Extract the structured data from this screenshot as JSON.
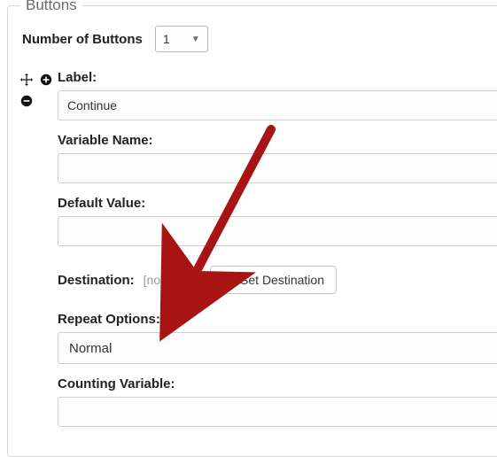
{
  "group": {
    "title": "Buttons",
    "number_label": "Number of Buttons",
    "number_value": "1"
  },
  "button": {
    "label_label": "Label:",
    "label_value": "Continue",
    "variable_label": "Variable Name:",
    "variable_value": "",
    "default_label": "Default Value:",
    "default_value": "",
    "destination_label": "Destination:",
    "destination_value": "[no where]",
    "set_destination_label": "Set Destination",
    "repeat_label": "Repeat Options:",
    "repeat_value": "Normal",
    "counting_label": "Counting Variable:",
    "counting_value": ""
  },
  "annotation": {
    "arrow_color": "#a81414"
  }
}
